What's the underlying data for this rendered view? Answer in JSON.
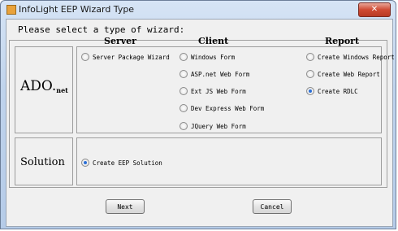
{
  "window": {
    "title": "InfoLight EEP Wizard Type",
    "close_glyph": "✕"
  },
  "prompt": "Please select a type of wizard:",
  "headers": {
    "server": "Server",
    "client": "Client",
    "report": "Report"
  },
  "rows": {
    "ado_label": "ADO.",
    "ado_sub": "net",
    "solution_label": "Solution"
  },
  "options": {
    "server": [
      {
        "label": "Server Package Wizard",
        "selected": false
      }
    ],
    "client": [
      {
        "label": "Windows Form",
        "selected": false
      },
      {
        "label": "ASP.net Web Form",
        "selected": false
      },
      {
        "label": "Ext JS Web Form",
        "selected": false
      },
      {
        "label": "Dev Express Web Form",
        "selected": false
      },
      {
        "label": "JQuery Web Form",
        "selected": false
      }
    ],
    "report": [
      {
        "label": "Create Windows Report",
        "selected": false
      },
      {
        "label": "Create Web Report",
        "selected": false
      },
      {
        "label": "Create RDLC",
        "selected": true
      }
    ],
    "solution": [
      {
        "label": "Create EEP Solution",
        "selected": true
      }
    ]
  },
  "buttons": {
    "next": "Next",
    "cancel": "Cancel"
  },
  "colors": {
    "accent": "#2b6fd6",
    "titlebar": "#bfd3ec",
    "close": "#cf4a33"
  }
}
